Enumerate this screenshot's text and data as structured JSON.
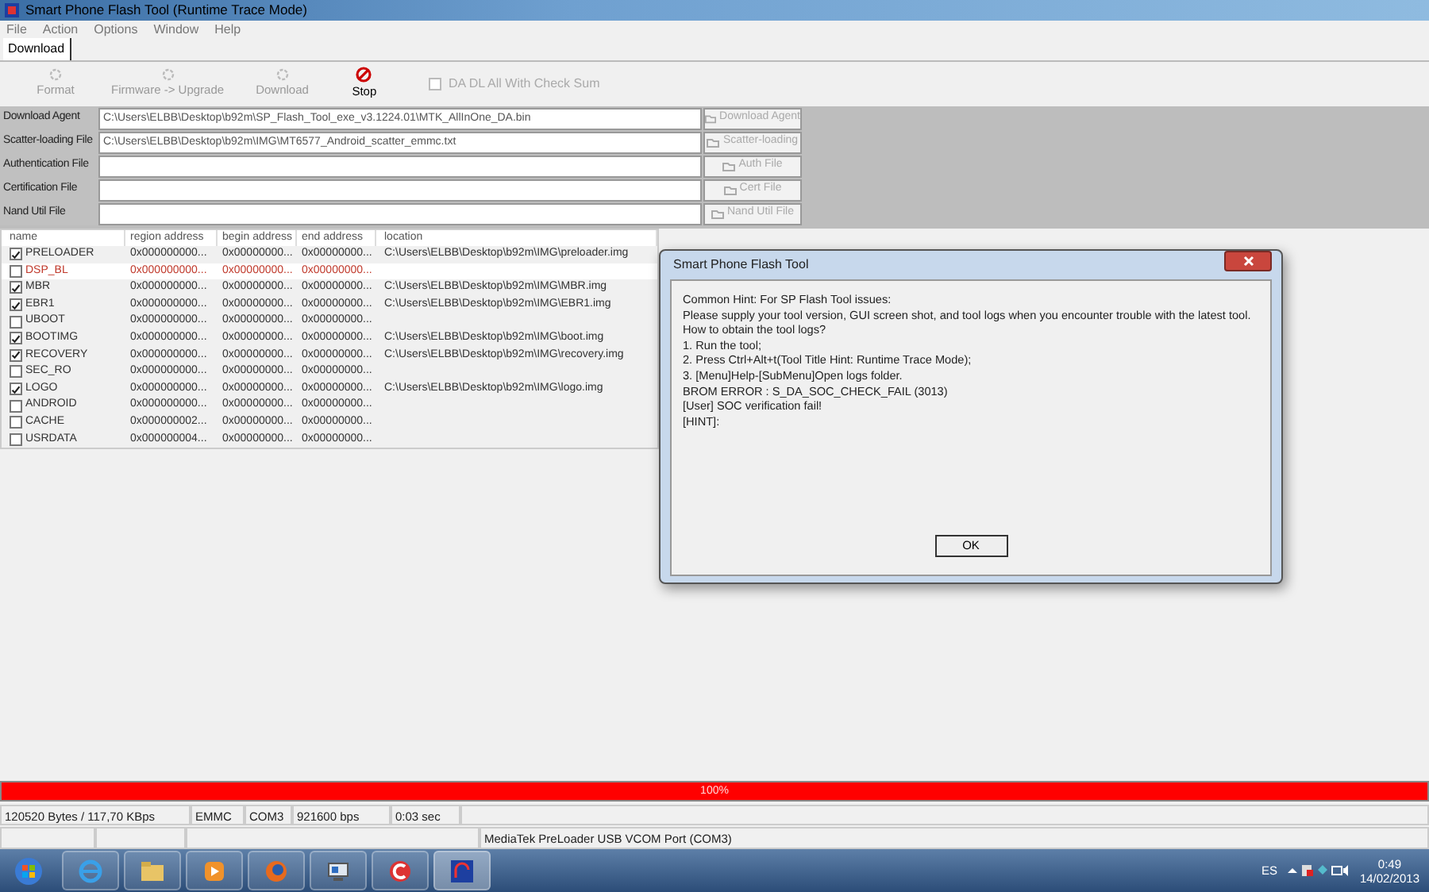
{
  "window": {
    "title": "Smart Phone Flash Tool (Runtime Trace Mode)"
  },
  "menu": [
    "File",
    "Action",
    "Options",
    "Window",
    "Help"
  ],
  "tabs": [
    {
      "label": "Download",
      "selected": true
    }
  ],
  "toolbar": [
    {
      "label": "Format",
      "disabled": true,
      "kind": "tool"
    },
    {
      "label": "Firmware -> Upgrade",
      "disabled": true,
      "kind": "tool"
    },
    {
      "label": "Download",
      "disabled": true,
      "kind": "tool"
    },
    {
      "label": "Stop",
      "disabled": false,
      "kind": "stop"
    }
  ],
  "checksum": {
    "label": "DA DL All With Check Sum",
    "checked": false,
    "disabled": true
  },
  "files": [
    {
      "label": "Download Agent",
      "value": "C:\\Users\\ELBB\\Desktop\\b92m\\SP_Flash_Tool_exe_v3.1224.01\\MTK_AllInOne_DA.bin",
      "button": "Download Agent"
    },
    {
      "label": "Scatter-loading File",
      "value": "C:\\Users\\ELBB\\Desktop\\b92m\\IMG\\MT6577_Android_scatter_emmc.txt",
      "button": "Scatter-loading"
    },
    {
      "label": "Authentication File",
      "button": "Auth File"
    },
    {
      "label": "Certification File",
      "button": "Cert File"
    },
    {
      "label": "Nand Util File",
      "button": "Nand Util File"
    }
  ],
  "table": {
    "columns": [
      "name",
      "region address",
      "begin address",
      "end address",
      "location"
    ],
    "rows": [
      {
        "name": "PRELOADER",
        "checked": true,
        "invalid": false,
        "region": "0x000000000...",
        "begin": "0x00000000...",
        "end": "0x00000000...",
        "location": "C:\\Users\\ELBB\\Desktop\\b92m\\IMG\\preloader.img"
      },
      {
        "name": "DSP_BL",
        "checked": false,
        "invalid": true,
        "region": "0x000000000...",
        "begin": "0x00000000...",
        "end": "0x00000000..."
      },
      {
        "name": "MBR",
        "checked": true,
        "invalid": false,
        "region": "0x000000000...",
        "begin": "0x00000000...",
        "end": "0x00000000...",
        "location": "C:\\Users\\ELBB\\Desktop\\b92m\\IMG\\MBR.img"
      },
      {
        "name": "EBR1",
        "checked": true,
        "invalid": false,
        "region": "0x000000000...",
        "begin": "0x00000000...",
        "end": "0x00000000...",
        "location": "C:\\Users\\ELBB\\Desktop\\b92m\\IMG\\EBR1.img"
      },
      {
        "name": "UBOOT",
        "checked": false,
        "invalid": false,
        "region": "0x000000000...",
        "begin": "0x00000000...",
        "end": "0x00000000..."
      },
      {
        "name": "BOOTIMG",
        "checked": true,
        "invalid": false,
        "region": "0x000000000...",
        "begin": "0x00000000...",
        "end": "0x00000000...",
        "location": "C:\\Users\\ELBB\\Desktop\\b92m\\IMG\\boot.img"
      },
      {
        "name": "RECOVERY",
        "checked": true,
        "invalid": false,
        "region": "0x000000000...",
        "begin": "0x00000000...",
        "end": "0x00000000...",
        "location": "C:\\Users\\ELBB\\Desktop\\b92m\\IMG\\recovery.img"
      },
      {
        "name": "SEC_RO",
        "checked": false,
        "invalid": false,
        "region": "0x000000000...",
        "begin": "0x00000000...",
        "end": "0x00000000..."
      },
      {
        "name": "LOGO",
        "checked": true,
        "invalid": false,
        "region": "0x000000000...",
        "begin": "0x00000000...",
        "end": "0x00000000...",
        "location": "C:\\Users\\ELBB\\Desktop\\b92m\\IMG\\logo.img"
      },
      {
        "name": "ANDROID",
        "checked": false,
        "invalid": false,
        "region": "0x000000000...",
        "begin": "0x00000000...",
        "end": "0x00000000..."
      },
      {
        "name": "CACHE",
        "checked": false,
        "invalid": false,
        "region": "0x000000002...",
        "begin": "0x00000000...",
        "end": "0x00000000..."
      },
      {
        "name": "USRDATA",
        "checked": false,
        "invalid": false,
        "region": "0x000000004...",
        "begin": "0x00000000...",
        "end": "0x00000000..."
      }
    ]
  },
  "progress": {
    "level": 1,
    "reading": "100%"
  },
  "status_bar": [
    "120520 Bytes / 117,70 KBps",
    "EMMC",
    "COM3",
    "921600 bps",
    "0:03 sec"
  ],
  "port": "MediaTek PreLoader USB VCOM Port (COM3)",
  "dialog": {
    "title": "Smart Phone Flash Tool",
    "paragraphs": [
      [
        "Common Hint: For SP Flash Tool issues:"
      ],
      [
        "Please supply your tool version, GUI screen shot, and tool logs when you encounter trouble with the latest tool.",
        "How to obtain the tool logs?",
        "1. Run the tool;",
        "2. Press Ctrl+Alt+t(Tool Title Hint: Runtime Trace Mode);",
        "3. [Menu]Help-[SubMenu]Open logs folder."
      ],
      [
        "BROM ERROR : S_DA_SOC_CHECK_FAIL (3013)"
      ],
      [
        "[User] SOC verification fail!"
      ],
      [
        "[HINT]:"
      ]
    ],
    "button": "OK"
  },
  "taskbar": {
    "apps": [
      {
        "kind": "browser"
      },
      {
        "kind": "folder"
      },
      {
        "kind": "media"
      },
      {
        "kind": "firefox"
      },
      {
        "kind": "installer"
      },
      {
        "kind": "cleaner"
      },
      {
        "kind": "flash",
        "selected": true
      }
    ],
    "language": "ES",
    "time": "0:49",
    "date": "14/02/2013"
  }
}
